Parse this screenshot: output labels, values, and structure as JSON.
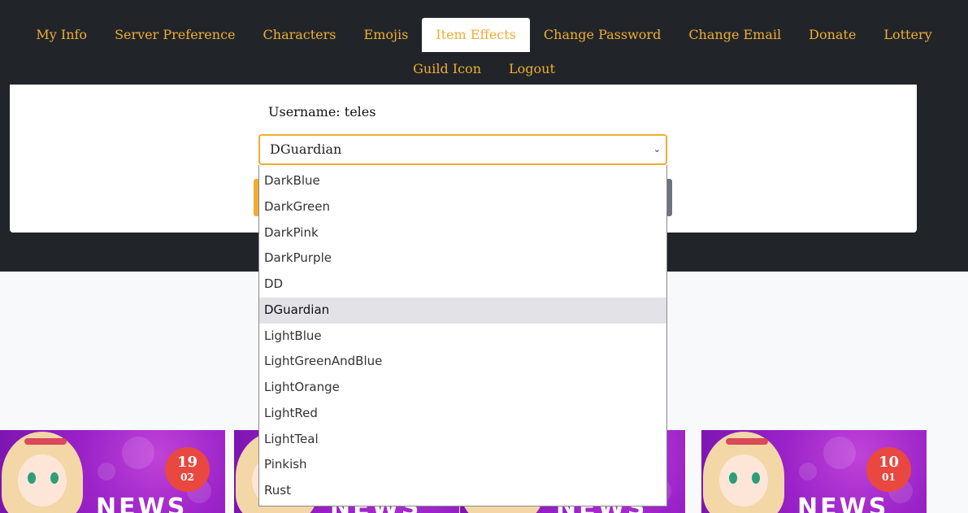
{
  "nav": {
    "row1": [
      {
        "label": "My Info",
        "name": "nav-my-info"
      },
      {
        "label": "Server Preference",
        "name": "nav-server-preference"
      },
      {
        "label": "Characters",
        "name": "nav-characters"
      },
      {
        "label": "Emojis",
        "name": "nav-emojis"
      },
      {
        "label": "Item Effects",
        "name": "nav-item-effects",
        "active": true
      },
      {
        "label": "Change Password",
        "name": "nav-change-password"
      },
      {
        "label": "Change Email",
        "name": "nav-change-email"
      },
      {
        "label": "Donate",
        "name": "nav-donate"
      },
      {
        "label": "Lottery",
        "name": "nav-lottery"
      }
    ],
    "row2": [
      {
        "label": "Guild Icon",
        "name": "nav-guild-icon"
      },
      {
        "label": "Logout",
        "name": "nav-logout"
      }
    ]
  },
  "form": {
    "username_label": "Username: teles",
    "selected_effect": "DGuardian"
  },
  "dropdown": {
    "options": [
      "DarkBlue",
      "DarkGreen",
      "DarkPink",
      "DarkPurple",
      "DD",
      "DGuardian",
      "LightBlue",
      "LightGreenAndBlue",
      "LightOrange",
      "LightRed",
      "LightTeal",
      "Pinkish",
      "Rust"
    ],
    "highlighted_index": 5
  },
  "news": [
    {
      "day": "19",
      "month": "02",
      "banner": "NEWS"
    },
    {
      "day": "",
      "month": "",
      "banner": "NEWS"
    },
    {
      "day": "",
      "month": "",
      "banner": "NEWS"
    },
    {
      "day": "10",
      "month": "01",
      "banner": "NEWS"
    }
  ],
  "colors": {
    "accent": "#f0ad32",
    "dark_bg": "#212529",
    "badge": "#e8483f",
    "news_bg": "#9a22c8"
  }
}
